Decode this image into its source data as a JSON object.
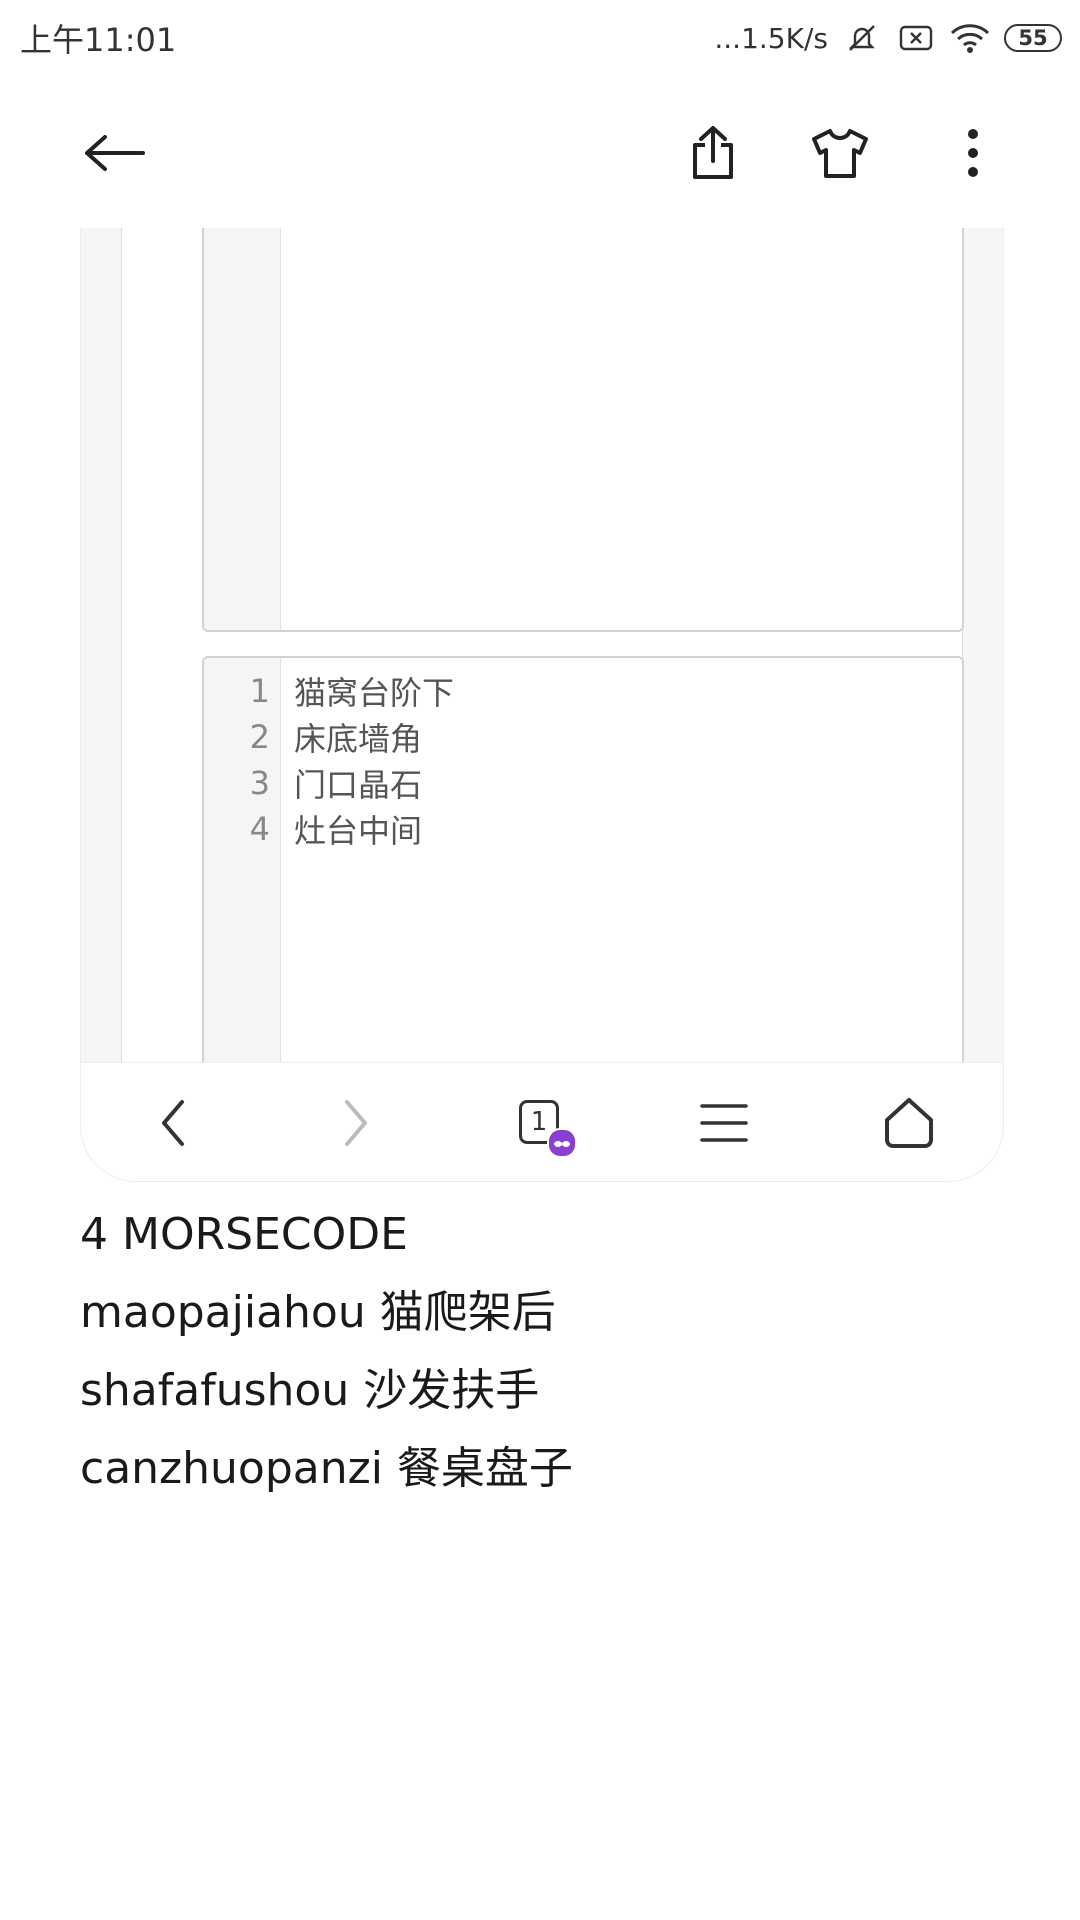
{
  "status_bar": {
    "time": "上午11:01",
    "net_speed": "...1.5K/s",
    "battery": "55"
  },
  "toolbar": {
    "back_icon": "arrow-left-icon",
    "share_icon": "share-icon",
    "theme_icon": "tshirt-icon",
    "more_icon": "more-vertical-icon"
  },
  "editor_lines": [
    {
      "num": "1",
      "text": "猫窝台阶下"
    },
    {
      "num": "2",
      "text": "床底墙角"
    },
    {
      "num": "3",
      "text": "门口晶石"
    },
    {
      "num": "4",
      "text": "灶台中间"
    }
  ],
  "browser_nav": {
    "tab_count": "1"
  },
  "content_lines": [
    "4 MORSECODE",
    "maopajiahou 猫爬架后",
    "shafafushou 沙发扶手",
    "canzhuopanzi 餐桌盘子"
  ]
}
